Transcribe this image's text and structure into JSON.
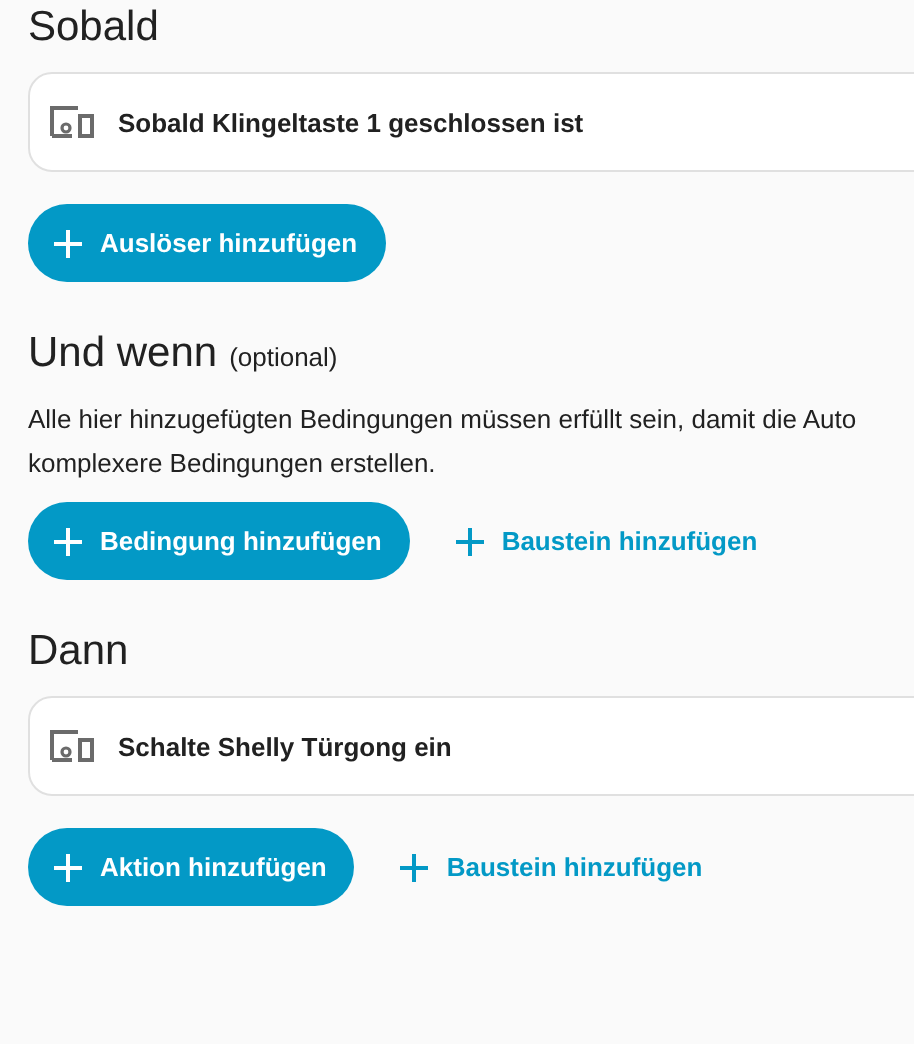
{
  "sections": [
    {
      "title": "Sobald",
      "items": [
        {
          "label": "Sobald Klingeltaste 1 geschlossen ist"
        }
      ],
      "actions": [
        {
          "kind": "filled",
          "label": "Auslöser hinzufügen"
        }
      ]
    },
    {
      "title": "Und wenn",
      "note": "(optional)",
      "description": [
        "Alle hier hinzugefügten Bedingungen müssen erfüllt sein, damit die Auto",
        "komplexere Bedingungen erstellen."
      ],
      "actions": [
        {
          "kind": "filled",
          "label": "Bedingung hinzufügen"
        },
        {
          "kind": "text",
          "label": "Baustein hinzufügen"
        }
      ]
    },
    {
      "title": "Dann",
      "items": [
        {
          "label": "Schalte Shelly Türgong ein"
        }
      ],
      "actions": [
        {
          "kind": "filled",
          "label": "Aktion hinzufügen"
        },
        {
          "kind": "text",
          "label": "Baustein hinzufügen"
        }
      ]
    }
  ]
}
